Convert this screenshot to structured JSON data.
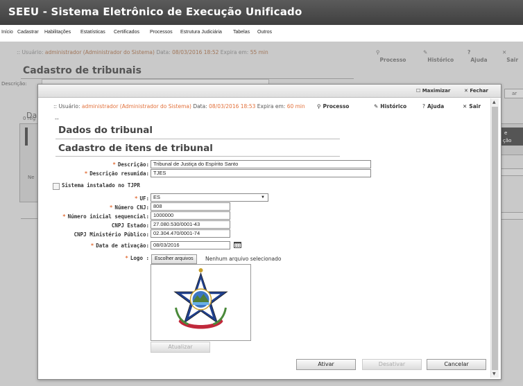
{
  "app": {
    "title": "SEEU - Sistema Eletrônico de Execução Unificado"
  },
  "menu": [
    "Início",
    "Cadastrar",
    "Habilitações",
    "Estatísticas",
    "Certificados",
    "Processos",
    "Estrutura Judiciária",
    "Tabelas",
    "Outros"
  ],
  "background": {
    "status_prefix": ":: Usuário:",
    "user": "administrador (Administrador do Sistema)",
    "data_label": "Data:",
    "date": "08/03/2016 18:52",
    "expira_label": "Expira em:",
    "expira": "55 min",
    "actions": {
      "processo": "Processo",
      "historico": "Histórico",
      "ajuda": "Ajuda",
      "sair": "Sair"
    },
    "page_title": "Cadastro de tribunais",
    "desc_label": "Descrição:",
    "partial_title": "Da",
    "partial_reg": "0 reg",
    "partial_ne": "Ne",
    "partial_right1": "e",
    "partial_right2": "ção",
    "partial_btn": "ar"
  },
  "modal": {
    "maximizar": "Maximizar",
    "fechar": "Fechar",
    "status_prefix": ":: Usuário:",
    "user": "administrador (Administrador do Sistema)",
    "data_label": "Data:",
    "date": "08/03/2016 18:53",
    "expira_label": "Expira em:",
    "expira": "60 min",
    "actions": {
      "processo": "Processo",
      "historico": "Histórico",
      "ajuda": "Ajuda",
      "sair": "Sair"
    },
    "dashes": "--",
    "section1": "Dados do tribunal",
    "section2": "Cadastro de itens de tribunal",
    "labels": {
      "descricao": "Descrição:",
      "descricao_resumida": "Descrição resumida:",
      "sistema": "Sistema instalado no TJPR",
      "uf": "UF:",
      "numero_cnj": "Número CNJ:",
      "numero_seq": "Número inicial sequencial:",
      "cnpj_estado": "CNPJ Estado:",
      "cnpj_mp": "CNPJ Ministério Público:",
      "data_ativacao": "Data de ativação:",
      "logo": "Logo :"
    },
    "values": {
      "descricao": "Tribunal de Justiça do Espírito Santo",
      "descricao_resumida": "TJES",
      "uf": "ES",
      "numero_cnj": "808",
      "numero_seq": "1000000",
      "cnpj_estado": "27.080.530/0001-43",
      "cnpj_mp": "02.304.470/0001-74",
      "data_ativacao": "08/03/2016"
    },
    "file_button": "Escolher arquivos",
    "no_file": "Nenhum arquivo selecionado",
    "atualizar": "Atualizar",
    "ativar": "Ativar",
    "desativar": "Desativar",
    "cancelar": "Cancelar"
  },
  "colors": {
    "accent": "#e2703a",
    "titlebar": "#4a4a4a"
  }
}
